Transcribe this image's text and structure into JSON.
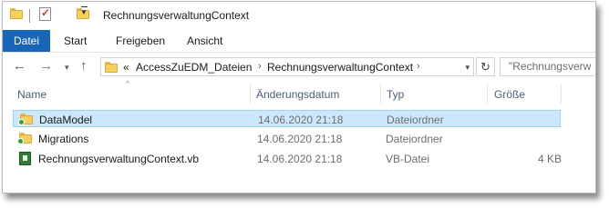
{
  "window": {
    "title": "RechnungsverwaltungContext"
  },
  "ribbon": {
    "file_tab": "Datei",
    "tabs": [
      "Start",
      "Freigeben",
      "Ansicht"
    ]
  },
  "nav": {
    "back_icon": "arrow-left-icon",
    "forward_icon": "arrow-right-icon",
    "up_icon": "arrow-up-icon",
    "overflow": "«",
    "breadcrumb": [
      "AccessZuEDM_Dateien",
      "RechnungsverwaltungContext"
    ],
    "search_placeholder": "\"Rechnungsverw"
  },
  "columns": {
    "name": "Name",
    "date": "Änderungsdatum",
    "type": "Typ",
    "size": "Größe"
  },
  "files": [
    {
      "name": "DataModel",
      "date": "14.06.2020 21:18",
      "type": "Dateiordner",
      "size": "",
      "icon": "folder-icon",
      "selected": true
    },
    {
      "name": "Migrations",
      "date": "14.06.2020 21:18",
      "type": "Dateiordner",
      "size": "",
      "icon": "folder-icon",
      "selected": false
    },
    {
      "name": "RechnungsverwaltungContext.vb",
      "date": "14.06.2020 21:18",
      "type": "VB-Datei",
      "size": "4 KB",
      "icon": "vb-file-icon",
      "selected": false
    }
  ],
  "colors": {
    "accent": "#1966b8",
    "selection": "#cce8ff",
    "selection_border": "#99d1ff"
  }
}
